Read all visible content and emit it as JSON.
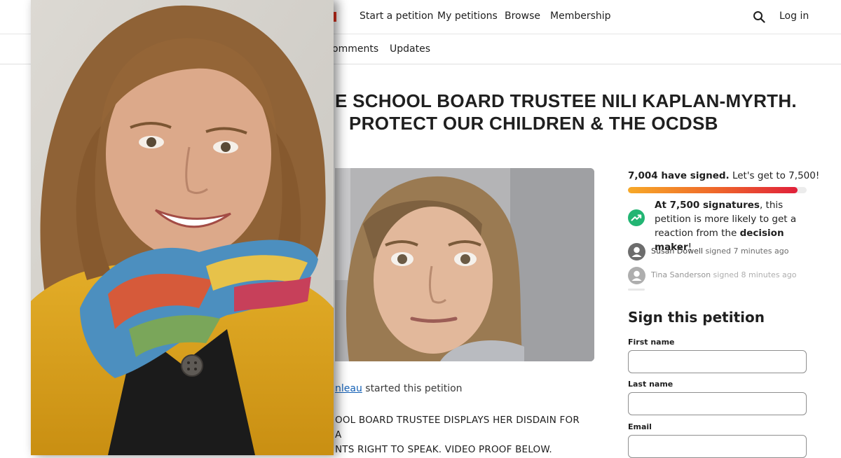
{
  "nav": {
    "links": [
      "Start a petition",
      "My petitions",
      "Browse",
      "Membership"
    ],
    "login": "Log in",
    "search_icon": "search-icon"
  },
  "subnav": {
    "tabs": [
      "Comments",
      "Updates"
    ],
    "first_tab_visible": "omments"
  },
  "petition": {
    "title_line1": "E SCHOOL BOARD TRUSTEE NILI KAPLAN-MYRTH.",
    "title_line2": "PROTECT OUR CHILDREN & THE OCDSB",
    "starter_name": "nleau",
    "starter_suffix": " started this petition",
    "body_line1": "OOL BOARD TRUSTEE DISPLAYS HER DISDAIN FOR A",
    "body_line2": "NTS RIGHT TO SPEAK.  VIDEO PROOF BELOW."
  },
  "progress": {
    "signed_bold": "7,004 have signed.",
    "goal_text": " Let's get to 7,500!",
    "signed": 7004,
    "goal": 7500,
    "fill_fraction": 0.95
  },
  "milestone": {
    "bold1": "At 7,500 signatures",
    "text1": ", this petition is more likely to get a reaction from the ",
    "bold2": "decision maker",
    "text2": "!"
  },
  "recent_signers": [
    {
      "name": "Susan Dowell",
      "action": " signed 7 minutes ago"
    },
    {
      "name": "Tina Sanderson",
      "action": " signed 8 minutes ago"
    }
  ],
  "form": {
    "heading": "Sign this petition",
    "first_name_label": "First name",
    "last_name_label": "Last name",
    "email_label": "Email"
  },
  "colors": {
    "accent": "#e0321f",
    "link": "#1561b6",
    "trend_badge": "#22b573",
    "progress_start": "#f7a928",
    "progress_end": "#e0203a"
  }
}
